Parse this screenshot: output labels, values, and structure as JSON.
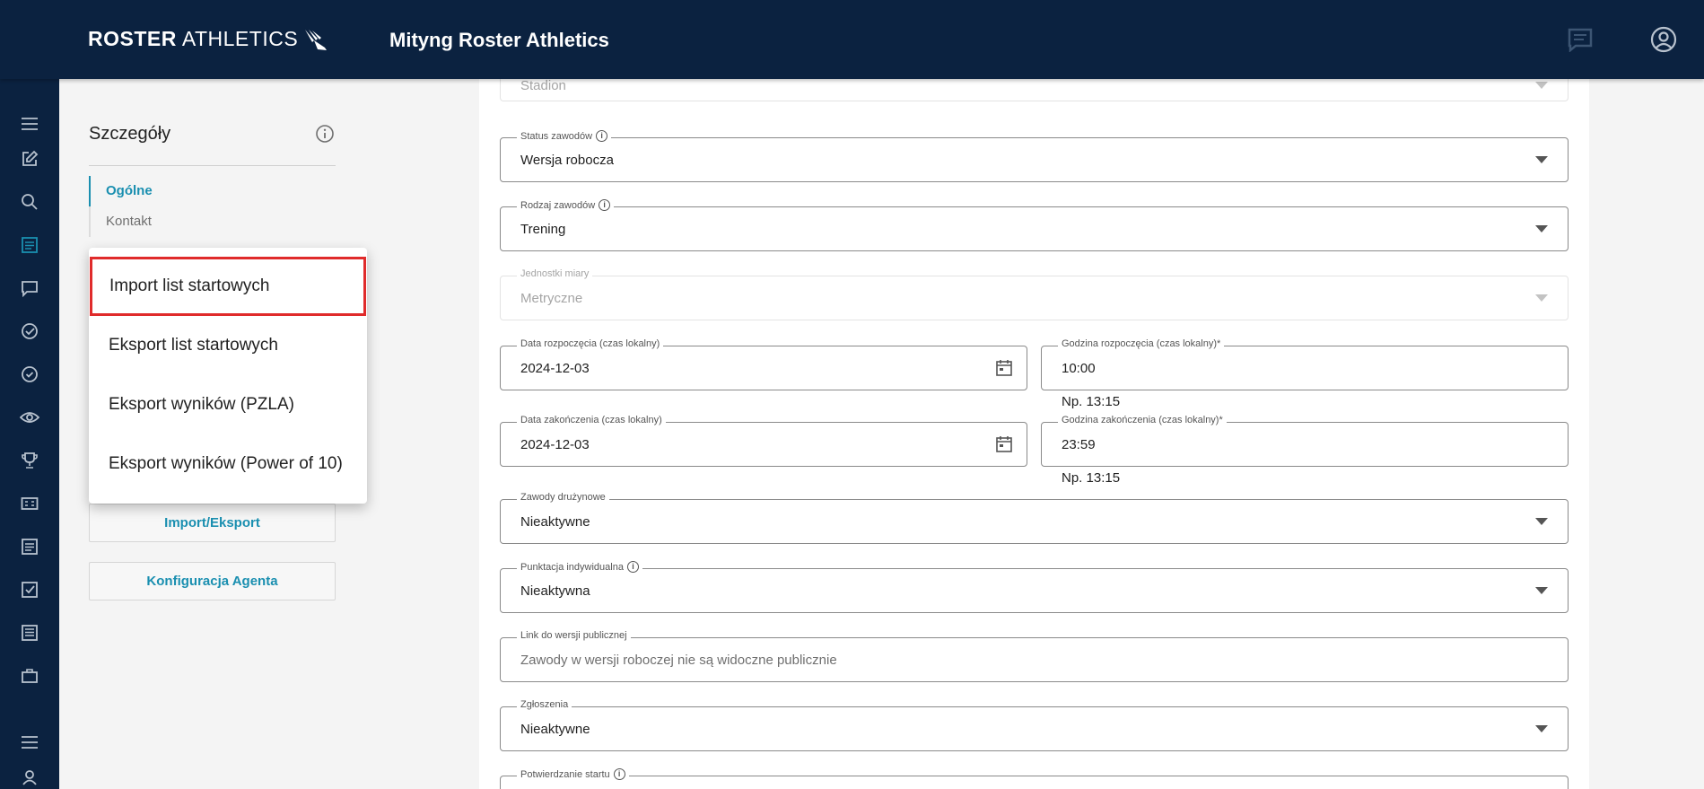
{
  "header": {
    "logo_bold": "ROSTER",
    "logo_light": "ATHLETICS",
    "title": "Mityng Roster Athletics"
  },
  "rail": {
    "icons": [
      "menu-icon",
      "edit-icon",
      "search-icon",
      "list-icon",
      "chat-icon",
      "check-circle-icon",
      "check-circle-icon",
      "eye-icon",
      "trophy-icon",
      "scoreboard-icon",
      "list-icon",
      "checkbox-icon",
      "document-icon",
      "briefcase-icon",
      "menu-icon",
      "user-icon"
    ]
  },
  "sidebar": {
    "title": "Szczegóły",
    "nav": [
      {
        "label": "Ogólne",
        "active": true
      },
      {
        "label": "Kontakt",
        "active": false
      }
    ],
    "import_export_label": "Import/Eksport",
    "agent_config_label": "Konfiguracja Agenta"
  },
  "menu": {
    "items": [
      {
        "label": "Import list startowych",
        "highlighted": true
      },
      {
        "label": "Eksport list startowych",
        "highlighted": false
      },
      {
        "label": "Eksport wyników (PZLA)",
        "highlighted": false
      },
      {
        "label": "Eksport wyników (Power of 10)",
        "highlighted": false
      }
    ]
  },
  "form": {
    "venue": {
      "value": "Stadion"
    },
    "status": {
      "label": "Status zawodów",
      "value": "Wersja robocza"
    },
    "type": {
      "label": "Rodzaj zawodów",
      "value": "Trening"
    },
    "units": {
      "label": "Jednostki miary",
      "value": "Metryczne"
    },
    "start_date": {
      "label": "Data rozpoczęcia (czas lokalny)",
      "value": "2024-12-03"
    },
    "start_time": {
      "label": "Godzina rozpoczęcia (czas lokalny)*",
      "value": "10:00",
      "hint": "Np. 13:15"
    },
    "end_date": {
      "label": "Data zakończenia (czas lokalny)",
      "value": "2024-12-03"
    },
    "end_time": {
      "label": "Godzina zakończenia (czas lokalny)*",
      "value": "23:59",
      "hint": "Np. 13:15"
    },
    "team": {
      "label": "Zawody drużynowe",
      "value": "Nieaktywne"
    },
    "individual": {
      "label": "Punktacja indywidualna",
      "value": "Nieaktywna"
    },
    "public_link": {
      "label": "Link do wersji publicznej",
      "placeholder": "Zawody w wersji roboczej nie są widoczne publicznie"
    },
    "entries": {
      "label": "Zgłoszenia",
      "value": "Nieaktywne"
    },
    "confirm": {
      "label": "Potwierdzanie startu"
    }
  },
  "colors": {
    "navy": "#0b2240",
    "accent": "#1a8fb0",
    "highlight": "#e02b2b"
  }
}
